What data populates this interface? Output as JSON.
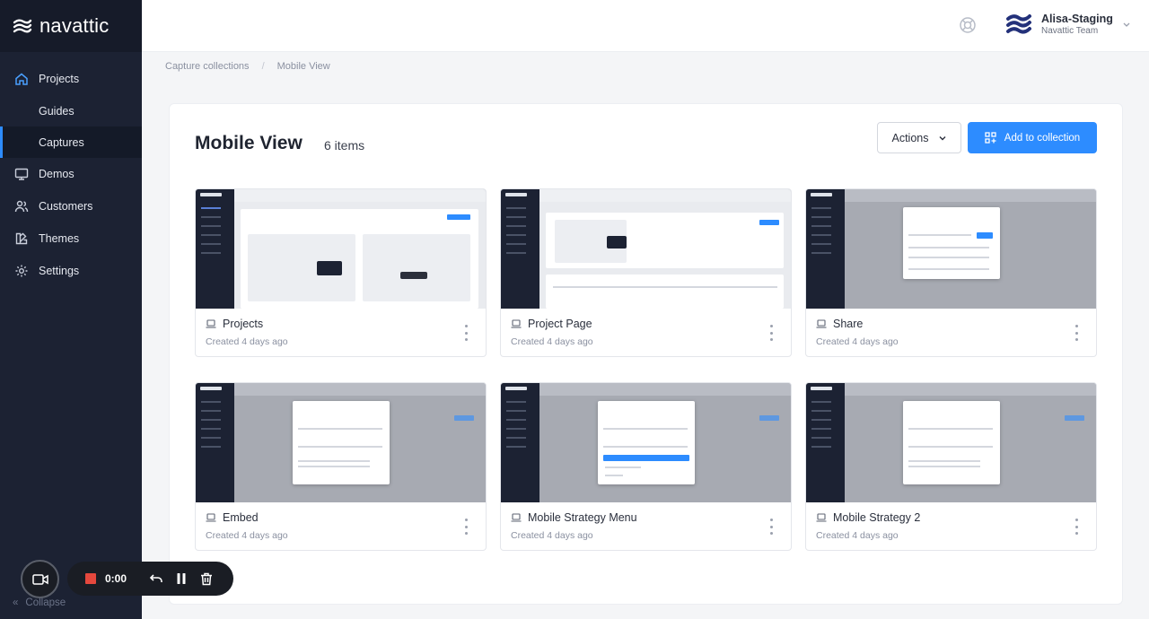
{
  "app": {
    "logo_text": "navattic"
  },
  "sidebar": {
    "items": [
      {
        "label": "Projects",
        "icon": "home-icon",
        "active": true
      },
      {
        "label": "Guides",
        "sub": true
      },
      {
        "label": "Captures",
        "sub": true,
        "active": true
      },
      {
        "label": "Demos",
        "icon": "monitor-icon"
      },
      {
        "label": "Customers",
        "icon": "users-icon"
      },
      {
        "label": "Themes",
        "icon": "palette-icon"
      },
      {
        "label": "Settings",
        "icon": "gear-icon"
      }
    ],
    "collapse_label": "Collapse"
  },
  "header": {
    "user_name": "Alisa-Staging",
    "user_team": "Navattic Team"
  },
  "breadcrumb": {
    "items": [
      "Capture collections",
      "Mobile View"
    ]
  },
  "main": {
    "title": "Mobile View",
    "count": "6 items",
    "actions_label": "Actions",
    "add_label": "Add to collection",
    "accent_color": "#2d8cff"
  },
  "cards": [
    {
      "name": "Projects",
      "date": "Created 4 days ago"
    },
    {
      "name": "Project Page",
      "date": "Created 4 days ago"
    },
    {
      "name": "Share",
      "date": "Created 4 days ago"
    },
    {
      "name": "Embed",
      "date": "Created 4 days ago"
    },
    {
      "name": "Mobile Strategy Menu",
      "date": "Created 4 days ago"
    },
    {
      "name": "Mobile Strategy 2",
      "date": "Created 4 days ago"
    }
  ],
  "recorder": {
    "time": "0:00",
    "stop_color": "#e5483d"
  }
}
